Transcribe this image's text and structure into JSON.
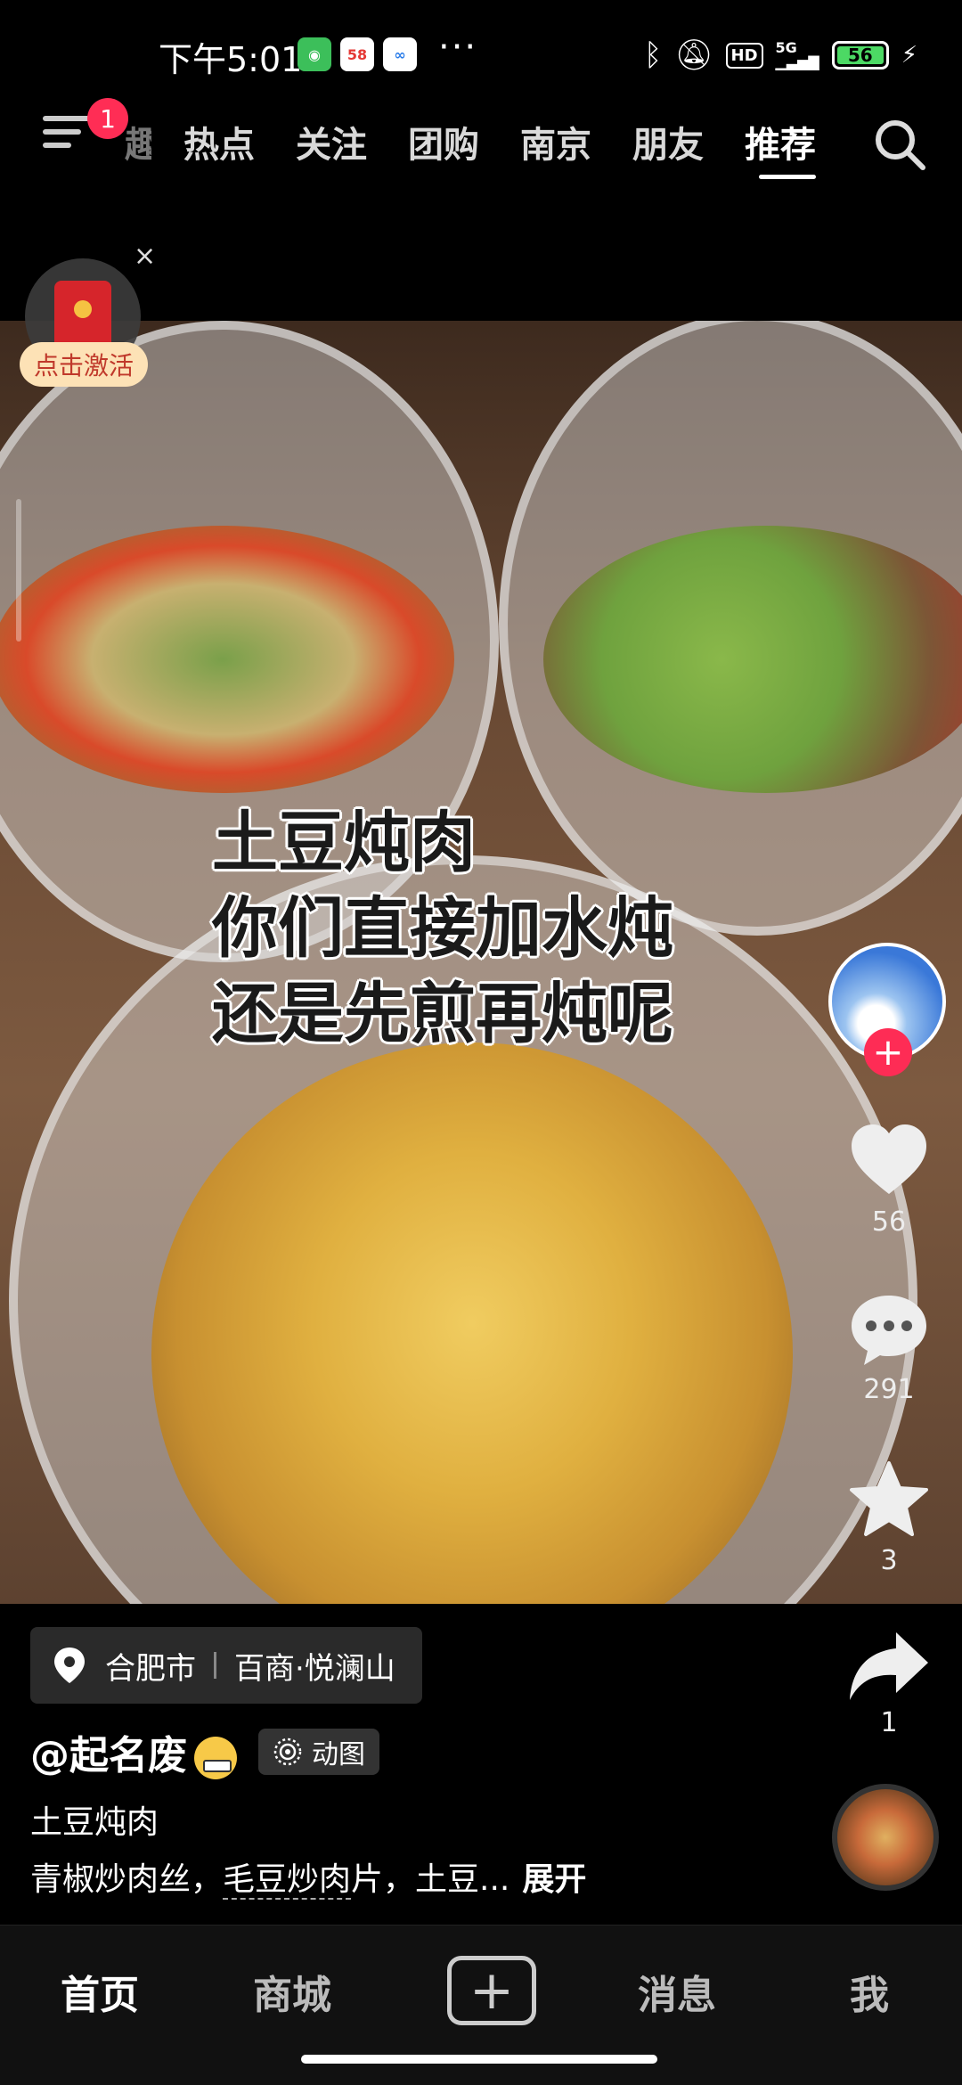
{
  "status_bar": {
    "time": "下午5:01",
    "apps": [
      "wechat-icon",
      "58-icon",
      "baidu-netdisk-icon"
    ],
    "dots": "···",
    "battery": "56"
  },
  "top_nav": {
    "badge": "1",
    "partial_tab": "趣",
    "tabs": [
      "热点",
      "关注",
      "团购",
      "南京",
      "朋友",
      "推荐"
    ],
    "active_tab": "推荐"
  },
  "redpacket": {
    "label": "点击激活",
    "close": "×"
  },
  "video": {
    "caption": [
      "土豆炖肉",
      "你们直接加水炖",
      "还是先煎再炖呢"
    ]
  },
  "actions": {
    "likes": "56",
    "comments": "291",
    "favorites": "3",
    "shares": "1"
  },
  "location": {
    "city": "合肥市",
    "place": "百商·悦澜山"
  },
  "post": {
    "author": "@起名废",
    "gif_tag": "动图",
    "title": "土豆炖肉",
    "body_start": "青椒炒肉丝，",
    "body_link": "毛豆炒肉",
    "body_end": "片，土豆...",
    "expand": "展开"
  },
  "bottom_nav": {
    "home": "首页",
    "mall": "商城",
    "messages": "消息",
    "me": "我"
  },
  "colors": {
    "accent": "#fe2c55",
    "background": "#000000",
    "bottom_bar": "#111111"
  }
}
